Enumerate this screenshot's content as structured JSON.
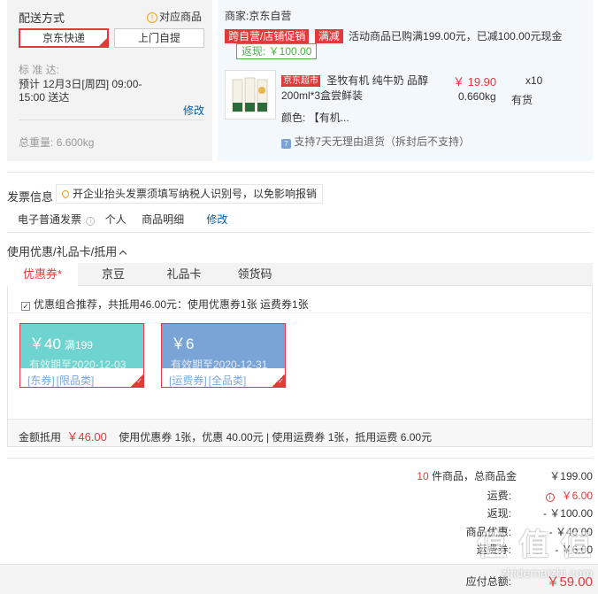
{
  "shipping": {
    "title": "配送方式",
    "matched_goods_link": "对应商品",
    "options": [
      "京东快递",
      "上门自提"
    ],
    "schedule_label": "标 准 达:",
    "schedule_text_1": "预计 12月3日[周四] 09:00-",
    "schedule_text_2": "15:00 送达",
    "modify": "修改",
    "total_weight_label": "总重量:",
    "total_weight_value": "6.600kg"
  },
  "merchant": {
    "label": "商家:",
    "name": "京东自营",
    "promo_tag": "跨自营/店铺促销",
    "full_reduce_tag": "满减",
    "promo_text": "活动商品已购满199.00元，已减100.00元现金",
    "rebate_tag": "返现: ￥100.00",
    "product": {
      "store_badge": "京东超市",
      "name_line1": "圣牧有机 纯牛奶 品醇",
      "name_line2": "200ml*3盒尝鲜装",
      "price": "￥ 19.90",
      "qty": "x10",
      "weight": "0.660kg",
      "stock": "有货",
      "color_label": "颜色:",
      "color_value": "【有机..."
    },
    "return_policy": "支持7天无理由退货（拆封后不支持）"
  },
  "invoice": {
    "title": "发票信息",
    "tip": "开企业抬头发票须填写纳税人识别号，以免影响报销",
    "type": "电子普通发票",
    "holder": "个人",
    "content": "商品明细",
    "modify": "修改"
  },
  "discount": {
    "title": "使用优惠/礼品卡/抵用",
    "tabs": [
      "优惠券*",
      "京豆",
      "礼品卡",
      "领货码"
    ],
    "combo_text": "优惠组合推荐，共抵用46.00元：使用优惠券1张 运费券1张",
    "coupons": [
      {
        "amount": "￥40",
        "condition": "满199",
        "expiry": "有效期至2020-12-03",
        "tags": [
          "[东券]",
          "[限品类]"
        ],
        "color": "#6fd3cf"
      },
      {
        "amount": "￥6",
        "condition": "",
        "expiry": "有效期至2020-12-31",
        "tags": [
          "[运费券]",
          "[全品类]"
        ],
        "color": "#7aa4d6"
      }
    ],
    "deduct_label": "金额抵用",
    "deduct_value": "￥46.00",
    "deduct_detail": "使用优惠券 1张，优惠 40.00元 | 使用运费券 1张，抵用运费 6.00元"
  },
  "summary": {
    "count": "10",
    "count_suffix": "件商品，总商品金",
    "total": "￥199.00",
    "shipping_label": "运费:",
    "shipping_value": "￥6.00",
    "rebate_label": "返现:",
    "rebate_value": "- ￥100.00",
    "coupon_label": "商品优惠:",
    "coupon_value": "- ￥40.00",
    "ship_coupon_label": "运费券:",
    "ship_coupon_value": "- ￥6.00",
    "payable_label": "应付总额:",
    "payable_value": "￥59.00"
  },
  "watermark": {
    "text": "值 值 值",
    "url": "zhidemaizhi.com"
  },
  "colors": {
    "accent": "#e4393c",
    "green": "#4cae4c",
    "link": "#005ea7",
    "coupon1": "#6fd3cf",
    "coupon2": "#7aa4d6"
  }
}
